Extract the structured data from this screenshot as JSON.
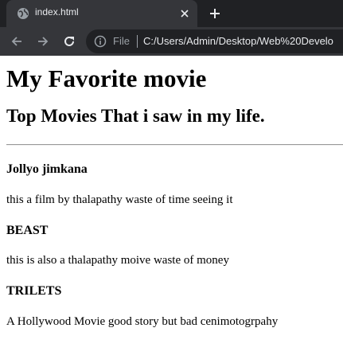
{
  "browser": {
    "tab": {
      "title": "index.html"
    },
    "toolbar": {
      "scheme_label": "File",
      "url": "C:/Users/Admin/Desktop/Web%20Develo"
    }
  },
  "page": {
    "title": "My Favorite movie",
    "subtitle": "Top Movies That i saw in my life.",
    "movies": [
      {
        "name": "Jollyo jimkana",
        "description": "this a film by thalapathy waste of time seeing it"
      },
      {
        "name": "BEAST",
        "description": "this is also a thalapathy moive waste of money"
      },
      {
        "name": "TRILETS",
        "description": "A Hollywood Movie good story but bad cenimotogrpahy"
      }
    ]
  }
}
